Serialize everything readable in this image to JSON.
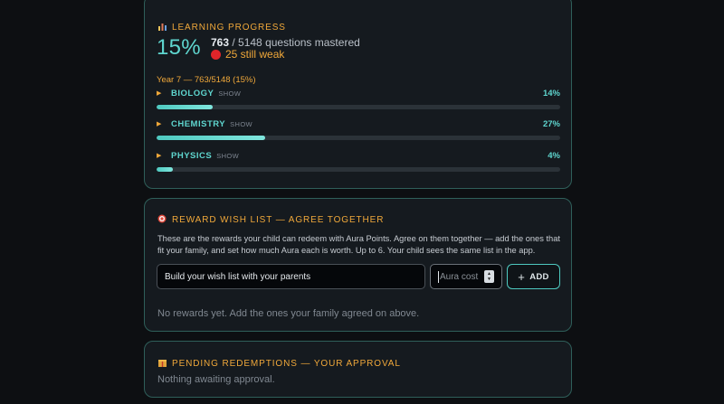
{
  "progress": {
    "icon": "bar-chart-icon",
    "title": "LEARNING PROGRESS",
    "percent": "15%",
    "mastered_count": "763",
    "mastered_rest": " / 5148 questions mastered",
    "weak_text": "25 still weak",
    "year_line": "Year 7 — 763/5148 (15%)",
    "subjects": [
      {
        "name": "BIOLOGY",
        "show": "SHOW",
        "pct": "14%",
        "fill": 0.14
      },
      {
        "name": "CHEMISTRY",
        "show": "SHOW",
        "pct": "27%",
        "fill": 0.27
      },
      {
        "name": "PHYSICS",
        "show": "SHOW",
        "pct": "4%",
        "fill": 0.04
      }
    ],
    "accent_color": "#5fd6cf",
    "title_color": "#f0a83a"
  },
  "wish": {
    "icon": "target-icon",
    "title": "REWARD WISH LIST — AGREE TOGETHER",
    "description": "These are the rewards your child can redeem with Aura Points. Agree on them together — add the ones that fit your family, and set how much Aura each is worth. Up to 6. Your child sees the same list in the app.",
    "input_value": "Build your wish list with your parents",
    "cost_placeholder": "Aura cost",
    "add_label": "ADD",
    "empty_text": "No rewards yet. Add the ones your family agreed on above."
  },
  "pending": {
    "icon": "gift-icon",
    "title": "PENDING REDEMPTIONS — YOUR APPROVAL",
    "empty_text": "Nothing awaiting approval."
  }
}
